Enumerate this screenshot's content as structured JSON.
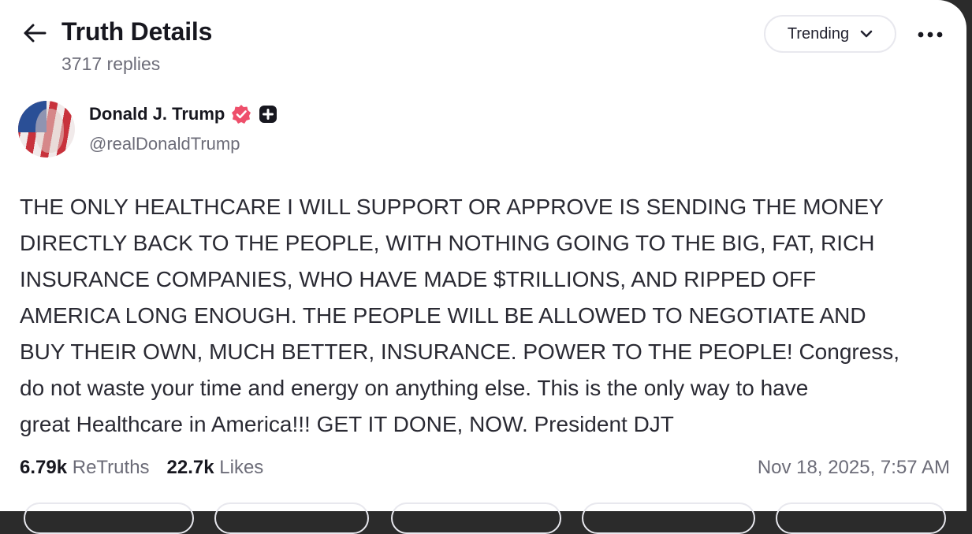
{
  "header": {
    "title": "Truth Details",
    "replies": "3717 replies",
    "sort_label": "Trending"
  },
  "author": {
    "name": "Donald J. Trump",
    "handle": "@realDonaldTrump"
  },
  "post": {
    "text": "THE ONLY HEALTHCARE I WILL SUPPORT OR APPROVE IS SENDING THE MONEY\nDIRECTLY BACK TO THE PEOPLE, WITH NOTHING GOING TO THE BIG, FAT, RICH\nINSURANCE COMPANIES, WHO HAVE MADE $TRILLIONS, AND RIPPED OFF\nAMERICA LONG ENOUGH. THE PEOPLE WILL BE ALLOWED TO NEGOTIATE AND\nBUY THEIR OWN, MUCH BETTER, INSURANCE. POWER TO THE PEOPLE! Congress,\ndo not waste your time and energy on anything else. This is the only way to have\ngreat Healthcare in America!!! GET IT DONE, NOW. President DJT",
    "retruths_count": "6.79k",
    "retruths_label": "ReTruths",
    "likes_count": "22.7k",
    "likes_label": "Likes",
    "timestamp": "Nov 18, 2025, 7:57 AM"
  },
  "icons": {
    "back": "arrow-left-icon",
    "sort": "chevron-down-icon",
    "more": "more-horizontal-icon",
    "verified": "verified-badge-icon",
    "plus": "plus-badge-icon"
  },
  "colors": {
    "verified": "#ee4f6b",
    "text": "#17171f",
    "muted": "#6c6c78"
  }
}
